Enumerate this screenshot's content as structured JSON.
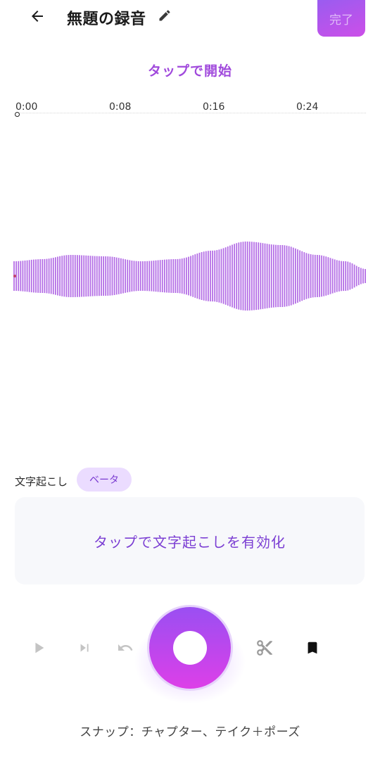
{
  "header": {
    "title": "無題の録音",
    "done_label": "完了"
  },
  "prompt": {
    "tap_start": "タップで開始"
  },
  "timeline": {
    "labels": [
      "0:00",
      "0:08",
      "0:16",
      "0:24"
    ]
  },
  "waveform": {
    "color": "#b46ee6"
  },
  "transcription": {
    "label": "文字起こし",
    "badge": "ベータ",
    "card_text": "タップで文字起こしを有効化"
  },
  "controls": {
    "snap_text": "スナップ：チャプター、テイク＋ポーズ"
  },
  "colors": {
    "accent": "#a049dc",
    "record_start": "#9a4ff2",
    "record_end": "#dd3fe8",
    "badge_bg": "#ebdcff"
  }
}
